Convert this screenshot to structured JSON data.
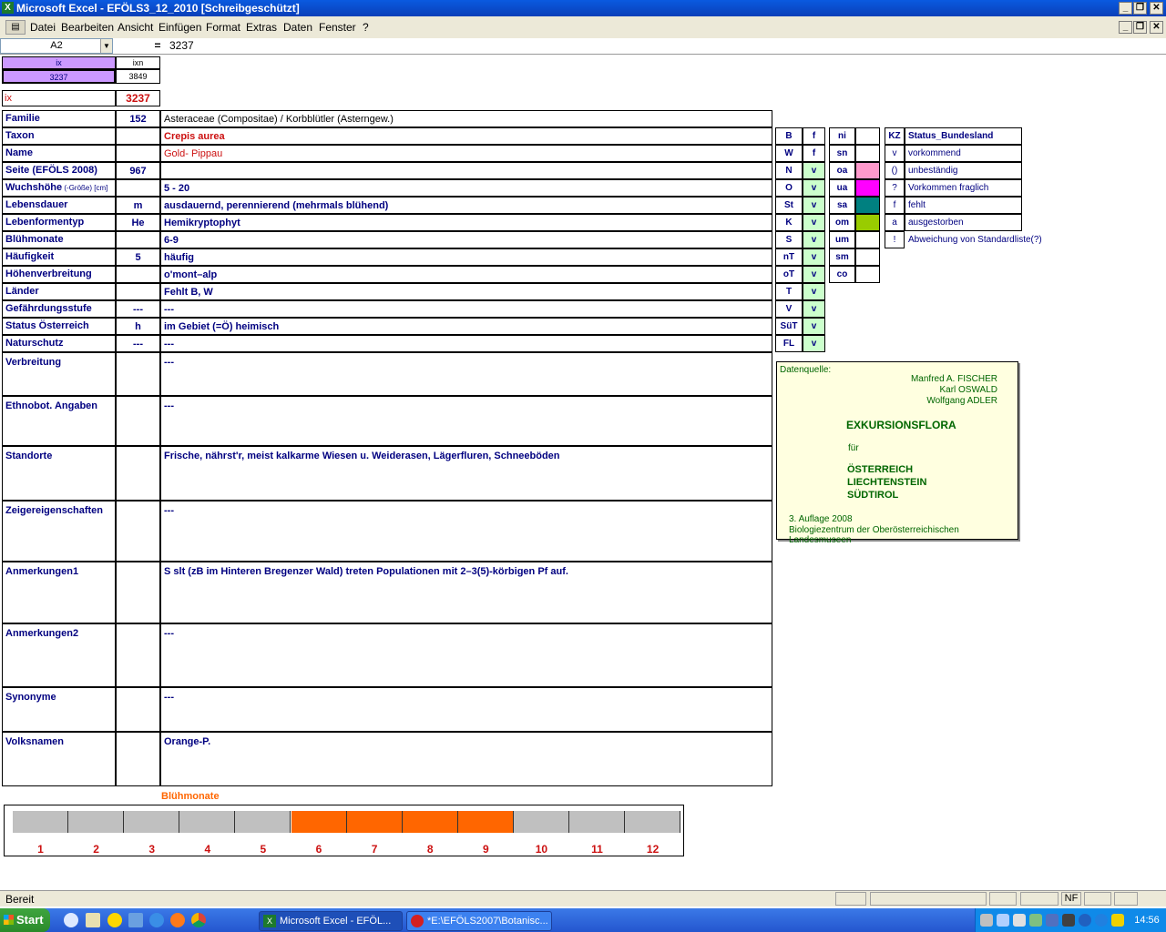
{
  "window": {
    "title": "Microsoft Excel - EFÖLS3_12_2010  [Schreibgeschützt]",
    "icon_name": "excel-icon"
  },
  "menu": {
    "items": [
      "Datei",
      "Bearbeiten",
      "Ansicht",
      "Einfügen",
      "Format",
      "Extras",
      "Daten",
      "Fenster",
      "?"
    ]
  },
  "formula_bar": {
    "name_box": "A2",
    "equals": "=",
    "value": "3237"
  },
  "index_box": {
    "h1": "ix",
    "h2": "ixn",
    "v1": "3237",
    "v2": "3849",
    "ix_label": "ix",
    "ix_value": "3237"
  },
  "rows": [
    {
      "label": "Familie",
      "code": "152",
      "text": "Asteraceae (Compositae)  /  Korbblütler (Asterngew.)"
    },
    {
      "label": "Taxon",
      "code": "",
      "text": "Crepis aurea"
    },
    {
      "label": "Name",
      "code": "",
      "text": "Gold- Pippau"
    },
    {
      "label": "Seite (EFÖLS 2008)",
      "code": "967",
      "text": ""
    },
    {
      "label": "Wuchshöhe",
      "label_suffix": " (-Größe) [cm]",
      "code": "",
      "text": " 5 - 20"
    },
    {
      "label": "Lebensdauer",
      "code": "m",
      "text": "ausdauernd, perennierend (mehrmals blühend)"
    },
    {
      "label": "Lebenformentyp",
      "code": "He",
      "text": "Hemikryptophyt"
    },
    {
      "label": "Blühmonate",
      "code": "",
      "text": " 6-9"
    },
    {
      "label": "Häufigkeit",
      "code": "5",
      "text": "häufig"
    },
    {
      "label": "Höhenverbreitung",
      "code": "",
      "text": "o'mont–alp"
    },
    {
      "label": "Länder",
      "code": "",
      "text": "Fehlt B, W"
    },
    {
      "label": "Gefährdungsstufe",
      "code": "---",
      "text": " ---"
    },
    {
      "label": "Status Österreich",
      "code": "h",
      "text": "im Gebiet (=Ö) heimisch"
    },
    {
      "label": "Naturschutz",
      "code": "---",
      "text": " ---"
    },
    {
      "label": "Verbreitung",
      "code": "",
      "text": " ---"
    },
    {
      "label": "Ethnobot. Angaben",
      "code": "",
      "text": "---"
    },
    {
      "label": "Standorte",
      "code": "",
      "text": "Frische, nährst'r, meist kalkarme Wiesen u. Weiderasen, Lägerfluren, Schneeböden"
    },
    {
      "label": "Zeigereigenschaften",
      "code": "",
      "text": "---"
    },
    {
      "label": "Anmerkungen1",
      "code": "",
      "text": "S slt (zB im Hinteren Bregenzer Wald) treten Populationen mit 2–3(5)-körbigen Pf auf."
    },
    {
      "label": "Anmerkungen2",
      "code": "",
      "text": "---"
    },
    {
      "label": "Synonyme",
      "code": "",
      "text": "---"
    },
    {
      "label": "Volksnamen",
      "code": "",
      "text": "Orange-P."
    }
  ],
  "bundesland_table": [
    {
      "code": "B",
      "status": "f"
    },
    {
      "code": "W",
      "status": "f"
    },
    {
      "code": "N",
      "status": "v"
    },
    {
      "code": "O",
      "status": "v"
    },
    {
      "code": "St",
      "status": "v"
    },
    {
      "code": "K",
      "status": "v"
    },
    {
      "code": "S",
      "status": "v"
    },
    {
      "code": "nT",
      "status": "v"
    },
    {
      "code": "oT",
      "status": "v"
    },
    {
      "code": "T",
      "status": "v"
    },
    {
      "code": "V",
      "status": "v"
    },
    {
      "code": "SüT",
      "status": "v"
    },
    {
      "code": "FL",
      "status": "v"
    }
  ],
  "height_table": [
    {
      "code": "ni",
      "color": "#ffffff"
    },
    {
      "code": "sn",
      "color": "#ffffff"
    },
    {
      "code": "oa",
      "color": "#ff99cc"
    },
    {
      "code": "ua",
      "color": "#ff00ff"
    },
    {
      "code": "sa",
      "color": "#008080"
    },
    {
      "code": "om",
      "color": "#99cc00"
    },
    {
      "code": "um",
      "color": "#ffffff"
    },
    {
      "code": "sm",
      "color": "#ffffff"
    },
    {
      "code": "co",
      "color": "#ffffff"
    }
  ],
  "status_legend": {
    "header_kz": "KZ",
    "header_title": "Status_Bundesland",
    "items": [
      {
        "kz": "v",
        "text": "vorkommend"
      },
      {
        "kz": "()",
        "text": "unbeständig"
      },
      {
        "kz": "?",
        "text": "Vorkommen fraglich"
      },
      {
        "kz": "f",
        "text": "fehlt"
      },
      {
        "kz": "a",
        "text": "ausgestorben"
      },
      {
        "kz": "!",
        "text": "Abweichung von Standardliste(?)"
      }
    ]
  },
  "source_box": {
    "label": "Datenquelle:",
    "author1": "Manfred A. FISCHER",
    "author2": "Karl OSWALD",
    "author3": "Wolfgang ADLER",
    "title": "EXKURSIONSFLORA",
    "fuer": "für",
    "country1": "ÖSTERREICH",
    "country2": "LIECHTENSTEIN",
    "country3": "SÜDTIROL",
    "edition": "3. Auflage 2008",
    "publisher": "Biologiezentrum der Oberösterreichischen Landesmuseen"
  },
  "chart_data": {
    "type": "bar",
    "title": "Blühmonate",
    "categories": [
      "1",
      "2",
      "3",
      "4",
      "5",
      "6",
      "7",
      "8",
      "9",
      "10",
      "11",
      "12"
    ],
    "values": [
      0,
      0,
      0,
      0,
      0,
      1,
      1,
      1,
      1,
      0,
      0,
      0
    ],
    "colors": {
      "active": "#ff6600",
      "inactive": "#c0c0c0"
    }
  },
  "statusbar": {
    "text": "Bereit",
    "nf": "NF"
  },
  "taskbar": {
    "start": "Start",
    "items": [
      {
        "label": "Microsoft Excel - EFÖL..."
      },
      {
        "label": "*E:\\EFÖLS2007\\Botanisc..."
      }
    ],
    "clock": "14:56"
  }
}
